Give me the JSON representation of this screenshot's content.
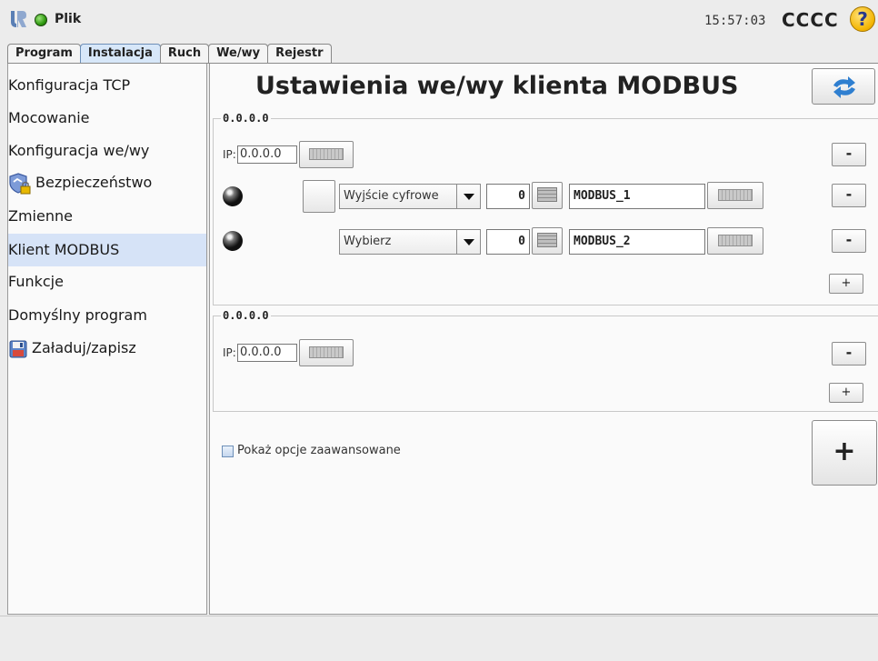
{
  "header": {
    "menu_label": "Plik",
    "time": "15:57:03",
    "robot_name": "CCCC",
    "help_label": "?"
  },
  "tabs": [
    {
      "label": "Program"
    },
    {
      "label": "Instalacja"
    },
    {
      "label": "Ruch"
    },
    {
      "label": "We/wy"
    },
    {
      "label": "Rejestr"
    }
  ],
  "sidebar": {
    "items": [
      {
        "label": "Konfiguracja TCP"
      },
      {
        "label": "Mocowanie"
      },
      {
        "label": "Konfiguracja we/wy"
      },
      {
        "label": "Bezpieczeństwo"
      },
      {
        "label": "Zmienne"
      },
      {
        "label": "Klient MODBUS"
      },
      {
        "label": "Funkcje"
      },
      {
        "label": "Domyślny program"
      },
      {
        "label": "Załaduj/zapisz"
      }
    ]
  },
  "main": {
    "title": "Ustawienia we/wy klienta MODBUS",
    "units": [
      {
        "label": "0.0.0.0",
        "ip_label": "IP:",
        "ip_value": "0.0.0.0",
        "signals": [
          {
            "type": "Wyjście cyfrowe",
            "address": "0",
            "name": "MODBUS_1"
          },
          {
            "type": "Wybierz",
            "address": "0",
            "name": "MODBUS_2"
          }
        ]
      },
      {
        "label": "0.0.0.0",
        "ip_label": "IP:",
        "ip_value": "0.0.0.0",
        "signals": []
      }
    ],
    "minus_label": "-",
    "plus_label": "+",
    "advanced_label": "Pokaż opcje zaawansowane",
    "add_unit_label": "+"
  }
}
